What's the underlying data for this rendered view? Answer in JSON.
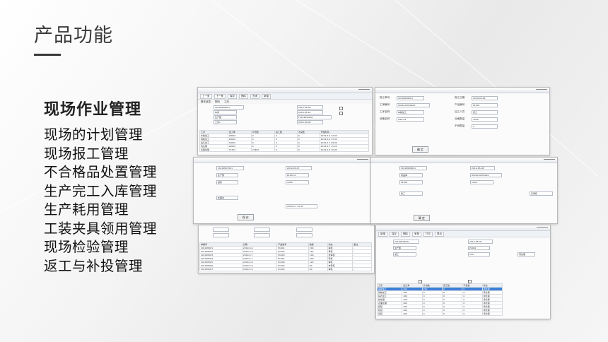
{
  "slide": {
    "title": "产品功能",
    "section_heading": "现场作业管理",
    "features": [
      "现场的计划管理",
      "现场报工管理",
      "不合格品处置管理",
      "生产完工入库管理",
      "生产耗用管理",
      "工装夹具领用管理",
      "现场检验管理",
      "返工与补投管理"
    ]
  },
  "screenshots": {
    "plan_window": {
      "toolbar": [
        "上一条",
        "下一条",
        "保存",
        "删除",
        "查询",
        "新增"
      ],
      "tabs": [
        "基本信息",
        "物料",
        "工序"
      ],
      "values": [
        "20190506001",
        "车间",
        "生产部",
        "2019-05-06",
        "2019-05-10",
        "F2019050601",
        "工序1",
        "2019-05-08"
      ],
      "table_header": [
        "工序",
        "加工单",
        "计划数",
        "完工数",
        "不良数",
        "开始时间"
      ],
      "table_rows": [
        [
          "车削加工",
          "20000",
          "0",
          "0",
          "0",
          "2019-5-6 12:00"
        ],
        [
          "铣削加工",
          "20000",
          "0",
          "0",
          "0",
          "2019-5-6 13:30"
        ],
        [
          "钻孔加工",
          "10000",
          "0",
          "0",
          "0",
          "2019-5-7 09:00"
        ],
        [
          "热处理",
          "20000",
          "0",
          "0",
          "0",
          "2019-5-7 15:20"
        ],
        [
          "表面处理",
          "74702",
          "74697",
          "0",
          "0",
          "2019-5-8 10:00"
        ]
      ]
    },
    "report_window": {
      "labels": [
        "报工单号",
        "报工日期",
        "工单编号",
        "产品编号",
        "工序名称",
        "加工人员",
        "设备名称",
        "合格数量",
        "不良数量"
      ],
      "values": [
        "20190506001",
        "2019-05-06",
        "WO2019050601",
        "P1001",
        "车削加工",
        "张三",
        "CNC-01",
        "1000",
        "0"
      ],
      "button": "确 定"
    },
    "defect_window": {
      "values": [
        "20190507001",
        "生产部",
        "2019-05-07",
        "P1001-A",
        "返修",
        "1000",
        "处理中",
        "2019-5-7 10:15"
      ],
      "button": "保 存"
    },
    "list_window": {
      "table_header": [
        "单据号",
        "日期",
        "产品编号",
        "数量",
        "状态",
        "备注"
      ],
      "table_rows": [
        [
          "201905001",
          "2019-5-6",
          "P1001",
          "200",
          "审核",
          "-"
        ],
        [
          "201905002",
          "2019-5-6",
          "P1002",
          "150",
          "审核",
          "-"
        ],
        [
          "201905003",
          "2019-5-7",
          "P1003",
          "100",
          "未审核",
          "-"
        ],
        [
          "201905004",
          "2019-5-7",
          "P1001",
          "300",
          "审核",
          "-"
        ],
        [
          "201905005",
          "2019-5-8",
          "P1004",
          "120",
          "审核",
          "-"
        ],
        [
          "201905006",
          "2019-5-8",
          "P1002",
          "80",
          "未审核",
          "-"
        ],
        [
          "201905007",
          "2019-5-9",
          "P1005",
          "60",
          "审核",
          "-"
        ]
      ]
    },
    "inbound_window": {
      "values": [
        "20190508001",
        "2019-05-08",
        "成品库",
        "WO2019050601",
        "P1001",
        "1000",
        "张三",
        "已审核"
      ],
      "button": "确 定"
    },
    "rework_window": {
      "toolbar": [
        "新增",
        "保存",
        "删除",
        "审核",
        "打印",
        "退出"
      ],
      "values": [
        "20190509001",
        "2019-05-09",
        "生产部",
        "P1001",
        "返工",
        "200",
        "待处理"
      ],
      "table_header": [
        "工序",
        "加工单",
        "计划数",
        "完工数",
        "不良数",
        "状态"
      ],
      "table_rows": [
        [
          "车削加工",
          "200",
          "200",
          "0",
          "0",
          "待处理"
        ],
        [
          "铣削加工",
          "200",
          "0",
          "0",
          "0",
          "待处理"
        ],
        [
          "钻孔加工",
          "200",
          "0",
          "0",
          "0",
          "待处理"
        ],
        [
          "热处理",
          "200",
          "0",
          "0",
          "0",
          "待处理"
        ],
        [
          "表面处理",
          "200",
          "0",
          "0",
          "0",
          "待处理"
        ],
        [
          "装配",
          "200",
          "0",
          "0",
          "0",
          "待处理"
        ],
        [
          "检验",
          "200",
          "0",
          "0",
          "0",
          "待处理"
        ],
        [
          "包装",
          "200",
          "0",
          "0",
          "0",
          "待处理"
        ]
      ]
    }
  }
}
